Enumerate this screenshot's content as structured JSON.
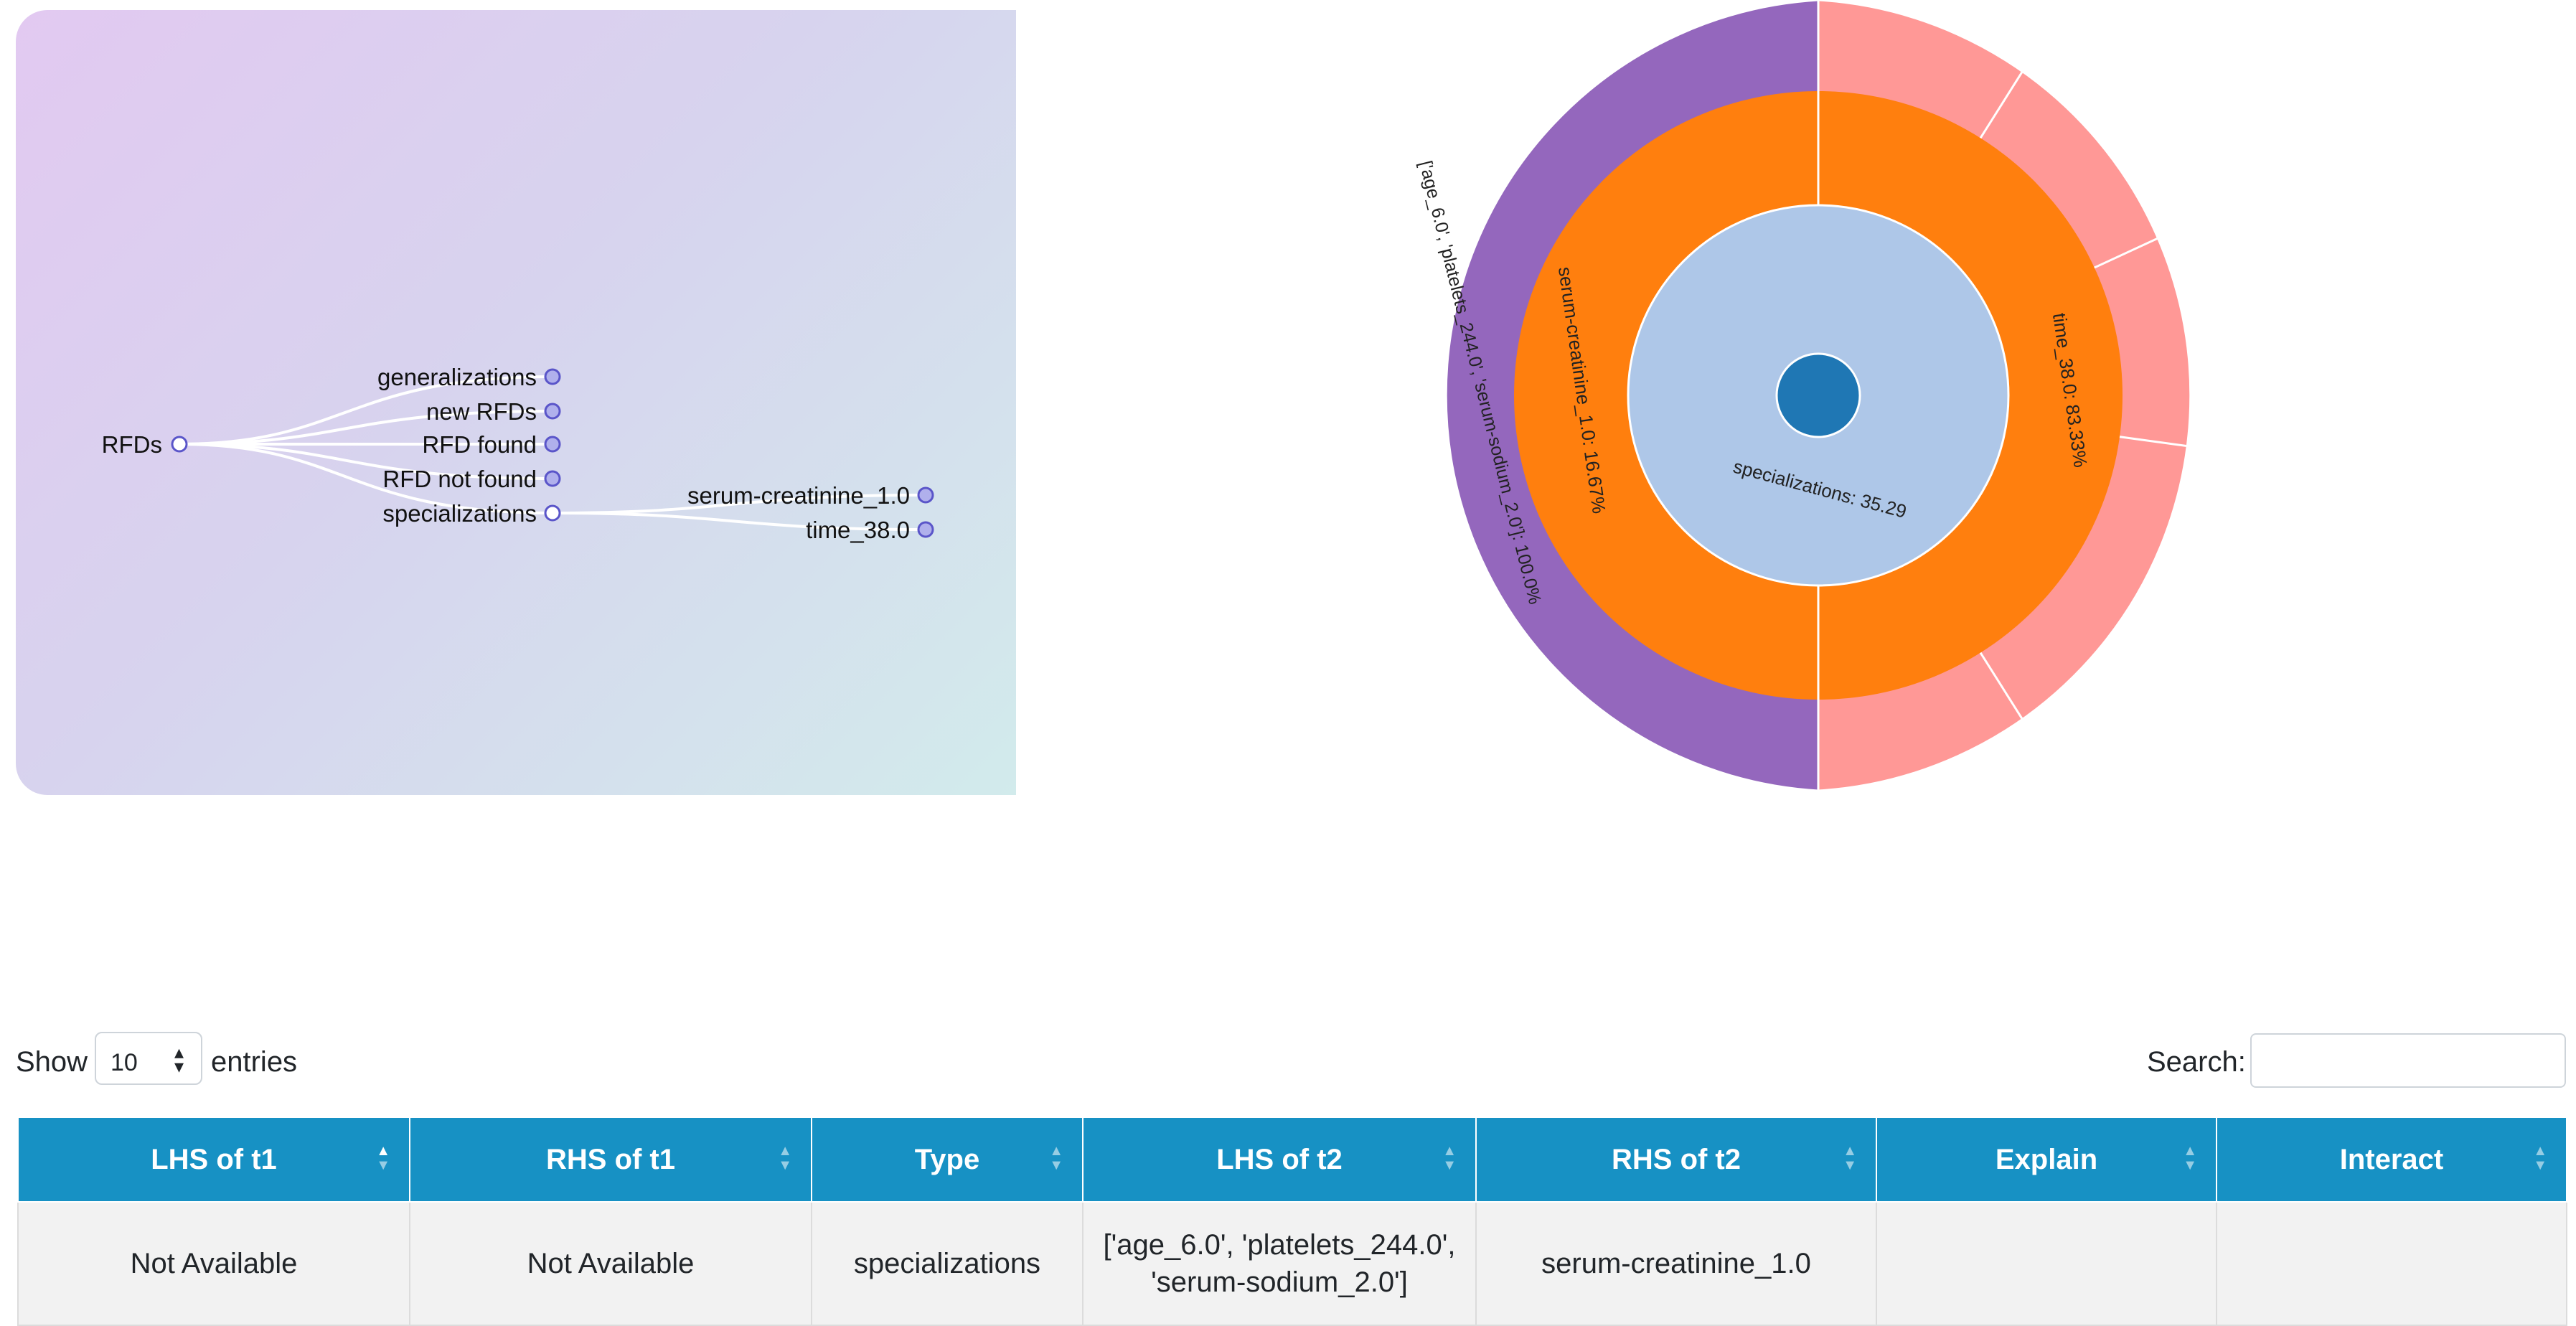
{
  "tree": {
    "root": "RFDs",
    "children": [
      "generalizations",
      "new RFDs",
      "RFD found",
      "RFD not found",
      "specializations"
    ],
    "specializations_children": [
      "serum-creatinine_1.0",
      "time_38.0"
    ]
  },
  "sunburst": {
    "center_label": "specializations: 35.29",
    "ring2": [
      {
        "label": "time_38.0: 83.33%",
        "value": 83.33
      },
      {
        "label": "serum-creatinine_1.0: 16.67%",
        "value": 16.67
      }
    ],
    "ring3_left_label": "['age_6.0', 'platelets_244.0', 'serum-sodium_2.0']: 100.0%",
    "colors": {
      "center": "#1f77b4",
      "inner": "#aec7e8",
      "middle": "#ff7f0e",
      "outer_left": "#9467bd",
      "outer_right": "#ff9896"
    }
  },
  "controls": {
    "show_label": "Show",
    "page_size": "10",
    "entries_label": "entries",
    "search_label": "Search:",
    "search_value": ""
  },
  "table": {
    "columns": [
      "LHS of t1",
      "RHS of t1",
      "Type",
      "LHS of t2",
      "RHS of t2",
      "Explain",
      "Interact"
    ],
    "rows": [
      {
        "lhs_t1": "Not Available",
        "rhs_t1": "Not Available",
        "type": "specializations",
        "lhs_t2_line1": "['age_6.0', 'platelets_244.0',",
        "lhs_t2_line2": "'serum-sodium_2.0']",
        "rhs_t2": "serum-creatinine_1.0",
        "explain": "",
        "interact": ""
      }
    ]
  }
}
